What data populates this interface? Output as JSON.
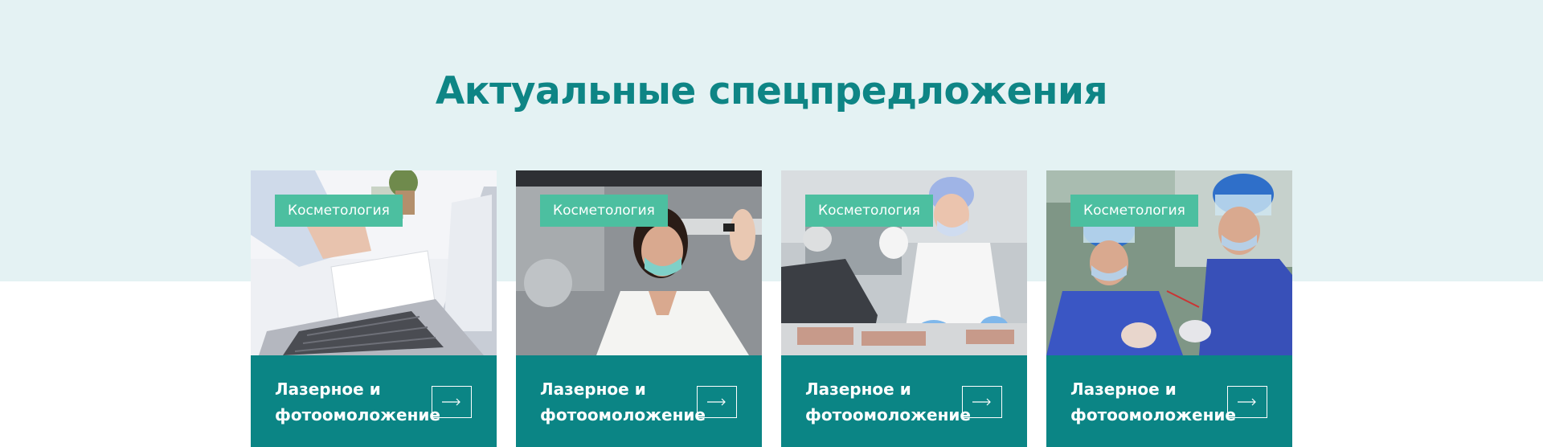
{
  "section": {
    "title": "Актуальные спецпредложения"
  },
  "colors": {
    "band_background": "#e4f2f3",
    "title": "#0e8585",
    "badge": "#4cbfa0",
    "card_footer": "#0b8585"
  },
  "cards": [
    {
      "category": "Косметология",
      "title": "Лазерное и фотоомоложение",
      "image": "laptop-workspace-photo",
      "arrow_icon": "arrow-right-icon"
    },
    {
      "category": "Косметология",
      "title": "Лазерное и фотоомоложение",
      "image": "lab-doctor-mask-photo",
      "arrow_icon": "arrow-right-icon"
    },
    {
      "category": "Косметология",
      "title": "Лазерное и фотоомоложение",
      "image": "lab-technicians-photo",
      "arrow_icon": "arrow-right-icon"
    },
    {
      "category": "Косметология",
      "title": "Лазерное и фотоомоложение",
      "image": "dental-procedure-photo",
      "arrow_icon": "arrow-right-icon"
    }
  ]
}
